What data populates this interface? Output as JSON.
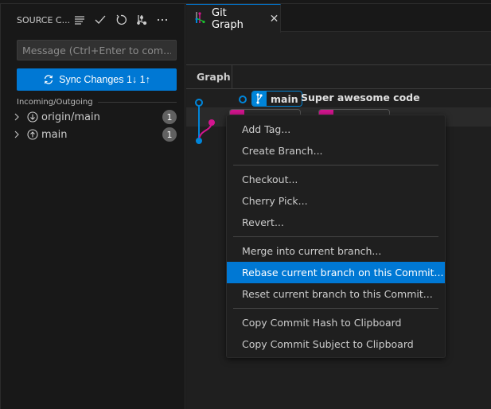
{
  "sidebar": {
    "title": "SOURCE C...",
    "actions": [
      {
        "name": "view-as-list-icon",
        "glyph": "≡"
      },
      {
        "name": "commit-checkmark-icon",
        "glyph": "✓"
      },
      {
        "name": "refresh-icon",
        "glyph": "↻"
      },
      {
        "name": "git-graph-icon",
        "glyph": ""
      },
      {
        "name": "more-actions-icon",
        "glyph": "···"
      }
    ],
    "message_placeholder": "Message (Ctrl+Enter to com...",
    "message_value": "",
    "sync_button": {
      "label": "Sync Changes 1↓ 1↑",
      "color": "#0078d4"
    },
    "section_title": "Incoming/Outgoing",
    "tree": [
      {
        "label": "origin/main",
        "icon": "incoming-arrow-down-icon",
        "count": "1"
      },
      {
        "label": "main",
        "icon": "outgoing-arrow-up-icon",
        "count": "1"
      }
    ]
  },
  "editor": {
    "tab": {
      "label": "Git Graph",
      "close": "✕"
    },
    "table_header": {
      "graph": "Graph"
    },
    "commits": [
      {
        "branch": "main",
        "message": "Super awesome code",
        "color": "#0085d9"
      },
      {
        "color": "#d3158f"
      }
    ]
  },
  "context_menu": {
    "groups": [
      [
        {
          "label": "Add Tag..."
        },
        {
          "label": "Create Branch..."
        }
      ],
      [
        {
          "label": "Checkout..."
        },
        {
          "label": "Cherry Pick..."
        },
        {
          "label": "Revert..."
        }
      ],
      [
        {
          "label": "Merge into current branch..."
        },
        {
          "label": "Rebase current branch on this Commit...",
          "active": true
        },
        {
          "label": "Reset current branch to this Commit..."
        }
      ],
      [
        {
          "label": "Copy Commit Hash to Clipboard"
        },
        {
          "label": "Copy Commit Subject to Clipboard"
        }
      ]
    ],
    "highlight_color": "#0078d4"
  }
}
